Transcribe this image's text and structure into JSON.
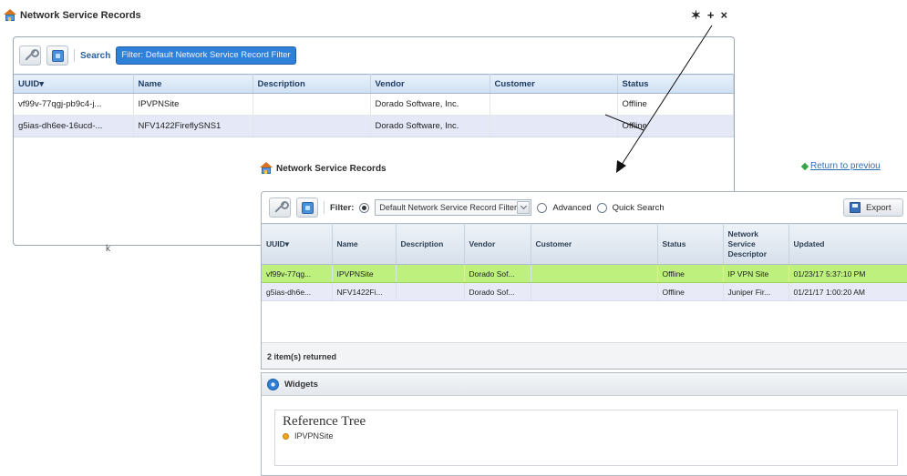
{
  "back": {
    "title": "Network Service Records",
    "tools": {
      "wrench": "✶",
      "plus": "+",
      "close": "×"
    },
    "search_label": "Search",
    "filter_chip": "Filter: Default Network Service Record Filter",
    "columns": [
      "UUID▾",
      "Name",
      "Description",
      "Vendor",
      "Customer",
      "Status"
    ],
    "rows": [
      [
        "vf99v-77qgj-pb9c4-j...",
        "IPVPNSite",
        "",
        "Dorado Software, Inc.",
        "",
        "Offline"
      ],
      [
        "g5ias-dh6ee-16ucd-...",
        "NFV1422FireflySNS1",
        "",
        "Dorado Software, Inc.",
        "",
        "Offline"
      ]
    ],
    "cursor_mark": "k"
  },
  "front": {
    "title": "Network Service Records",
    "return_link": "Return to previou",
    "filter_label": "Filter:",
    "filter_select": "Default Network Service Record Filter",
    "advanced_label": "Advanced",
    "quick_search_label": "Quick Search",
    "export_label": "Export",
    "columns": [
      "UUID▾",
      "Name",
      "Description",
      "Vendor",
      "Customer",
      "Status",
      "Network Service Descriptor",
      "Updated"
    ],
    "rows": [
      [
        "vf99v-77qg...",
        "IPVPNSite",
        "",
        "Dorado Sof...",
        "",
        "Offline",
        "IP VPN Site",
        "01/23/17 5:37:10 PM"
      ],
      [
        "g5ias-dh6e...",
        "NFV1422Fi...",
        "",
        "Dorado Sof...",
        "",
        "Offline",
        "Juniper Fir...",
        "01/21/17 1:00:20 AM"
      ]
    ],
    "items_returned": "2 item(s) returned",
    "widgets_label": "Widgets",
    "reference_tree_title": "Reference Tree",
    "reference_tree_item": "IPVPNSite"
  }
}
